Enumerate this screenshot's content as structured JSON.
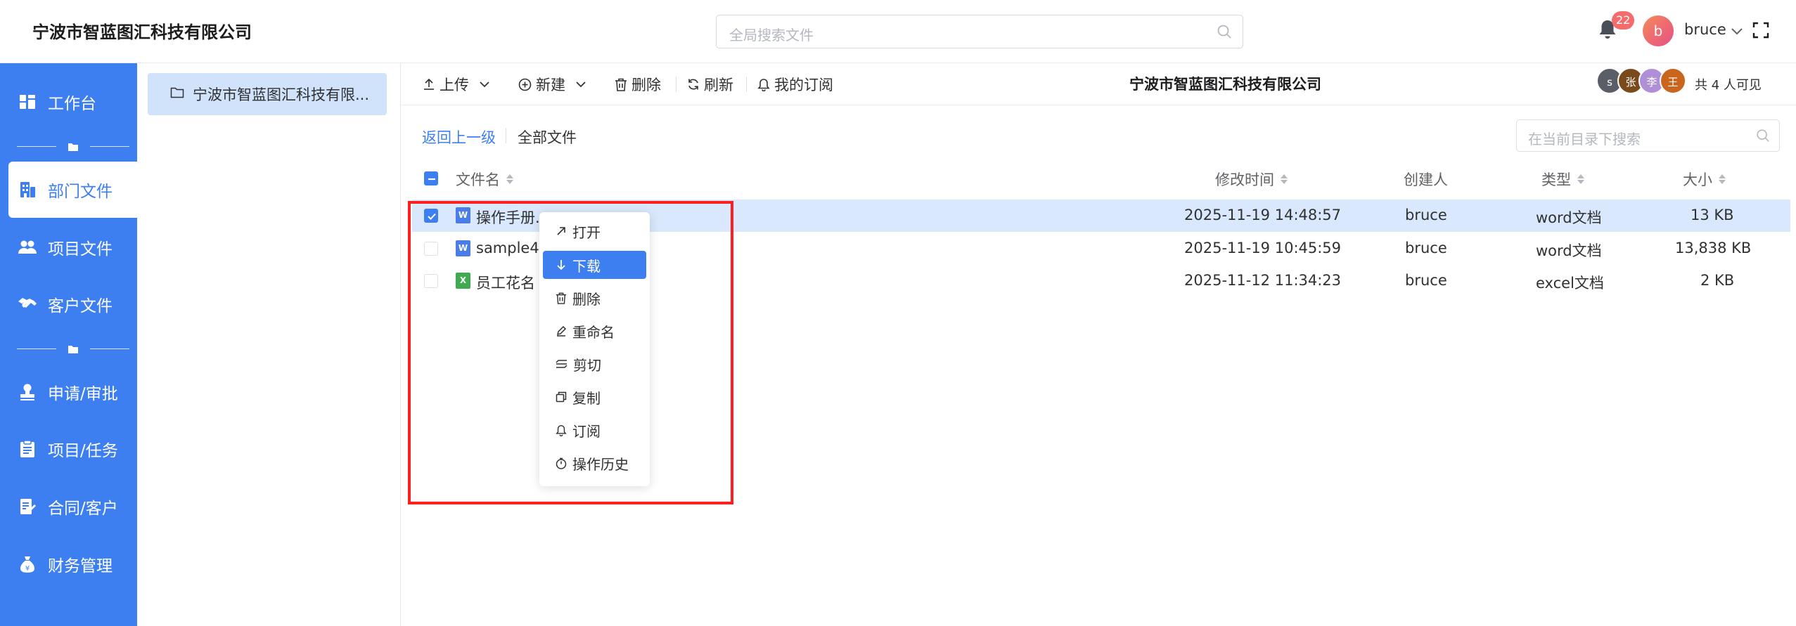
{
  "header": {
    "company": "宁波市智蓝图汇科技有限公司",
    "search_placeholder": "全局搜索文件",
    "notification_count": "22",
    "avatar_letter": "b",
    "username": "bruce"
  },
  "nav": {
    "items": [
      {
        "label": "工作台",
        "icon": "dashboard-icon"
      },
      {
        "label": "部门文件",
        "icon": "building-icon"
      },
      {
        "label": "项目文件",
        "icon": "team-icon"
      },
      {
        "label": "客户文件",
        "icon": "handshake-icon"
      },
      {
        "label": "申请/审批",
        "icon": "stamp-icon"
      },
      {
        "label": "项目/任务",
        "icon": "clipboard-icon"
      },
      {
        "label": "合同/客户",
        "icon": "contract-icon"
      },
      {
        "label": "财务管理",
        "icon": "money-bag-icon"
      }
    ],
    "active": "部门文件"
  },
  "tree": {
    "node_label": "宁波市智蓝图汇科技有限..."
  },
  "toolbar": {
    "upload": "上传",
    "new": "新建",
    "delete": "删除",
    "refresh": "刷新",
    "subscriptions": "我的订阅",
    "folder_title": "宁波市智蓝图汇科技有限公司",
    "members": [
      {
        "initial": "s",
        "color": "#5a5e66"
      },
      {
        "initial": "张",
        "color": "#7a4a1c"
      },
      {
        "initial": "李",
        "color": "#b08fd6"
      },
      {
        "initial": "王",
        "color": "#c9651c"
      }
    ],
    "visible_text": "共 4 人可见"
  },
  "path": {
    "back": "返回上一级",
    "all_files": "全部文件",
    "search_placeholder": "在当前目录下搜索"
  },
  "table": {
    "columns": {
      "name": "文件名",
      "modified": "修改时间",
      "creator": "创建人",
      "type": "类型",
      "size": "大小"
    },
    "rows": [
      {
        "name": "操作手册.",
        "icon": "W",
        "kind": "word",
        "modified": "2025-11-19 14:48:57",
        "creator": "bruce",
        "type": "word文档",
        "size": "13 KB",
        "selected": true
      },
      {
        "name": "sample4.c",
        "icon": "W",
        "kind": "word",
        "modified": "2025-11-19 10:45:59",
        "creator": "bruce",
        "type": "word文档",
        "size": "13,838 KB",
        "selected": false
      },
      {
        "name": "员工花名",
        "icon": "X",
        "kind": "excel",
        "modified": "2025-11-12 11:34:23",
        "creator": "bruce",
        "type": "excel文档",
        "size": "2 KB",
        "selected": false
      }
    ]
  },
  "context_menu": {
    "items": [
      {
        "label": "打开",
        "icon": "open-arrow-icon"
      },
      {
        "label": "下载",
        "icon": "download-icon"
      },
      {
        "label": "删除",
        "icon": "trash-icon"
      },
      {
        "label": "重命名",
        "icon": "pencil-icon"
      },
      {
        "label": "剪切",
        "icon": "cut-icon"
      },
      {
        "label": "复制",
        "icon": "copy-icon"
      },
      {
        "label": "订阅",
        "icon": "bell-icon"
      },
      {
        "label": "操作历史",
        "icon": "history-icon"
      }
    ],
    "highlighted": "下载"
  },
  "colors": {
    "accent": "#3d7ff0",
    "highlight_box": "#ff1f1f",
    "selected_row": "#d9e8fc"
  }
}
